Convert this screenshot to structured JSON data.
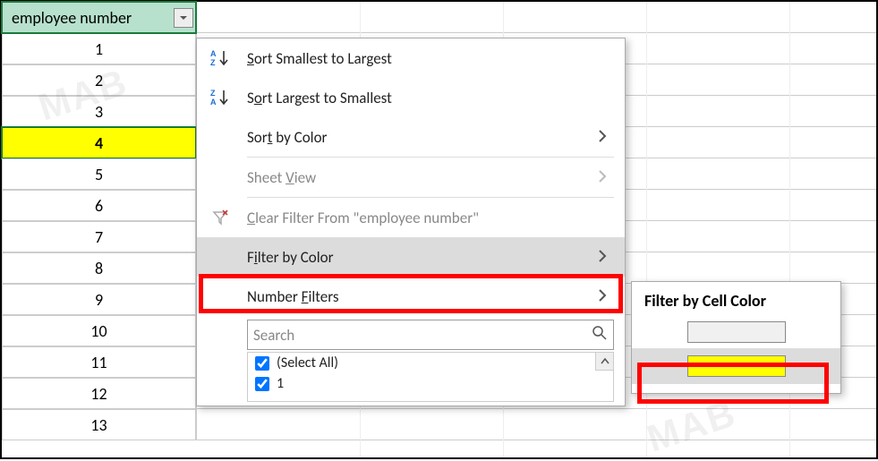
{
  "header": {
    "label": "employee number"
  },
  "rows": [
    "1",
    "2",
    "3",
    "4",
    "5",
    "6",
    "7",
    "8",
    "9",
    "10",
    "11",
    "12",
    "13"
  ],
  "highlighted_row_index": 3,
  "menu": {
    "sort_asc": "Sort Smallest to Largest",
    "sort_desc": "Sort Largest to Smallest",
    "sort_color": "Sort by Color",
    "sheet_view": "Sheet View",
    "clear_filter": "Clear Filter From \"employee number\"",
    "filter_color": "Filter by Color",
    "number_filters": "Number Filters",
    "search_placeholder": "Search",
    "select_all": "(Select All)",
    "item1": "1"
  },
  "submenu": {
    "title": "Filter by Cell Color",
    "colors": {
      "nofill": "#f0f0f0",
      "yellow": "#ffff00"
    }
  },
  "watermarks": [
    "MAB",
    "MAB",
    "MAB",
    "MAB"
  ]
}
